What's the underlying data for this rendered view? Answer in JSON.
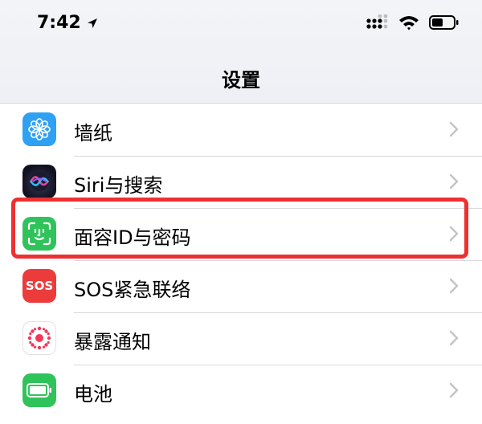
{
  "status": {
    "time": "7:42",
    "location_icon": "location-arrow-icon",
    "signal_icon": "cellular-signal-icon",
    "wifi_icon": "wifi-icon",
    "battery_icon": "battery-icon"
  },
  "nav": {
    "title": "设置"
  },
  "settings": {
    "rows": [
      {
        "label": "墙纸",
        "icon": "wallpaper-icon",
        "icon_color": "#2ea1f2"
      },
      {
        "label": "Siri与搜索",
        "icon": "siri-icon",
        "icon_color": "#1a1a2e"
      },
      {
        "label": "面容ID与密码",
        "icon": "face-id-icon",
        "icon_color": "#31c35b"
      },
      {
        "label": "SOS紧急联络",
        "icon": "sos-icon",
        "icon_color": "#ec3b3b",
        "icon_text": "SOS"
      },
      {
        "label": "暴露通知",
        "icon": "exposure-notification-icon",
        "icon_color": "#ffffff"
      },
      {
        "label": "电池",
        "icon": "battery-settings-icon",
        "icon_color": "#31c35b"
      }
    ]
  },
  "highlight": {
    "target": "面容ID与密码",
    "color": "#ee3030"
  }
}
